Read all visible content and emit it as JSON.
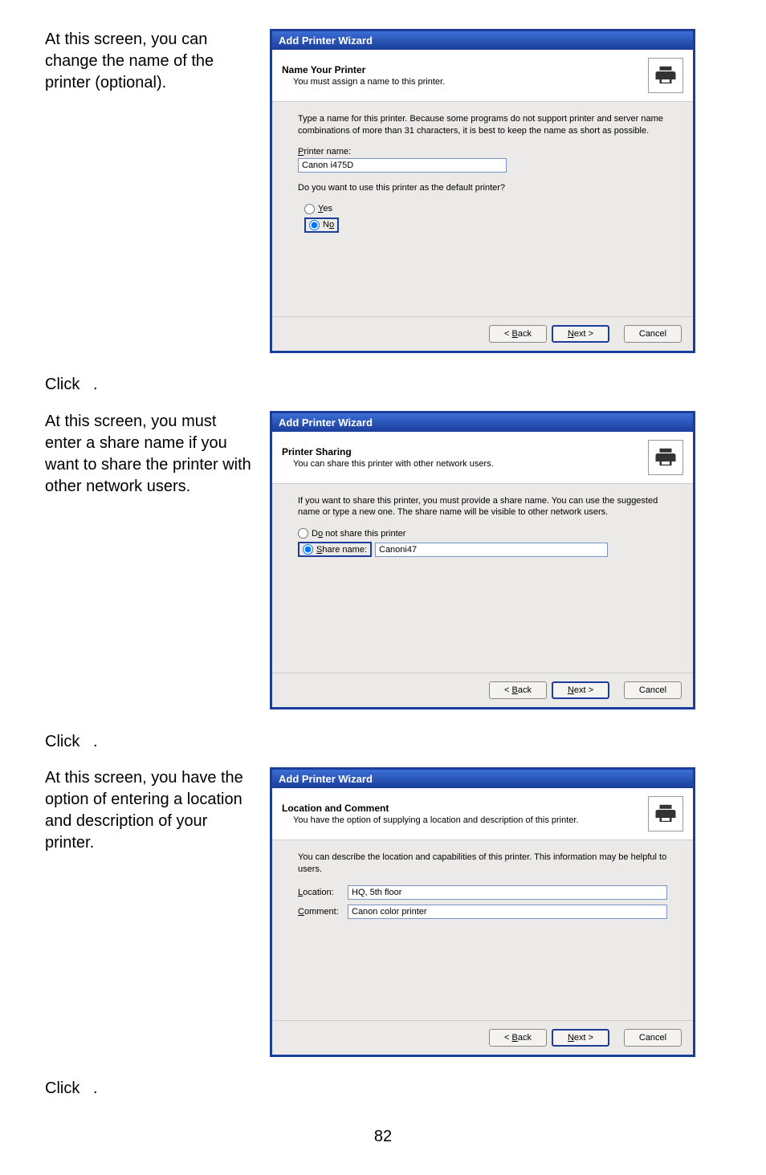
{
  "side": {
    "step1": "At this screen, you can change the name of the printer (optional).",
    "click1": "Click",
    "dot1": ".",
    "step2": "At this screen, you must enter a share name if you want to share the printer with other network users.",
    "click2": "Click",
    "dot2": ".",
    "step3": "At this screen, you have the option of entering a location and description of your printer.",
    "click3": "Click",
    "dot3": "."
  },
  "wiz1": {
    "title": "Add Printer Wizard",
    "h1": "Name Your Printer",
    "h2": "You must assign a name to this printer.",
    "body": "Type a name for this printer. Because some programs do not support printer and server name combinations of more than 31 characters, it is best to keep the name as short as possible.",
    "printer_label_u": "P",
    "printer_label_rest": "rinter name:",
    "printer_value": "Canon i475D",
    "q": "Do you want to use this printer as the default printer?",
    "yes_u": "Y",
    "yes_rest": "es",
    "no_u": "o",
    "no_pre": "N",
    "back_pre": "< ",
    "back_u": "B",
    "back_rest": "ack",
    "next_u": "N",
    "next_rest": "ext >",
    "cancel": "Cancel"
  },
  "wiz2": {
    "title": "Add Printer Wizard",
    "h1": "Printer Sharing",
    "h2": "You can share this printer with other network users.",
    "body": "If you want to share this printer, you must provide a share name. You can use the suggested name or type a new one. The share name will be visible to other network users.",
    "opt1_pre": "D",
    "opt1_u": "o",
    "opt1_rest": " not share this printer",
    "opt2_u": "S",
    "opt2_rest": "hare name:",
    "share_value": "Canoni47",
    "back_pre": "< ",
    "back_u": "B",
    "back_rest": "ack",
    "next_u": "N",
    "next_rest": "ext >",
    "cancel": "Cancel"
  },
  "wiz3": {
    "title": "Add Printer Wizard",
    "h1": "Location and Comment",
    "h2": "You have the option of supplying a location and description of this printer.",
    "body": "You can describe the location and capabilities of this printer. This information may be helpful to users.",
    "loc_u": "L",
    "loc_rest": "ocation:",
    "loc_value": "HQ, 5th floor",
    "com_u": "C",
    "com_rest": "omment:",
    "com_value": "Canon color printer",
    "back_pre": "< ",
    "back_u": "B",
    "back_rest": "ack",
    "next_u": "N",
    "next_rest": "ext >",
    "cancel": "Cancel"
  },
  "page_number": "82"
}
